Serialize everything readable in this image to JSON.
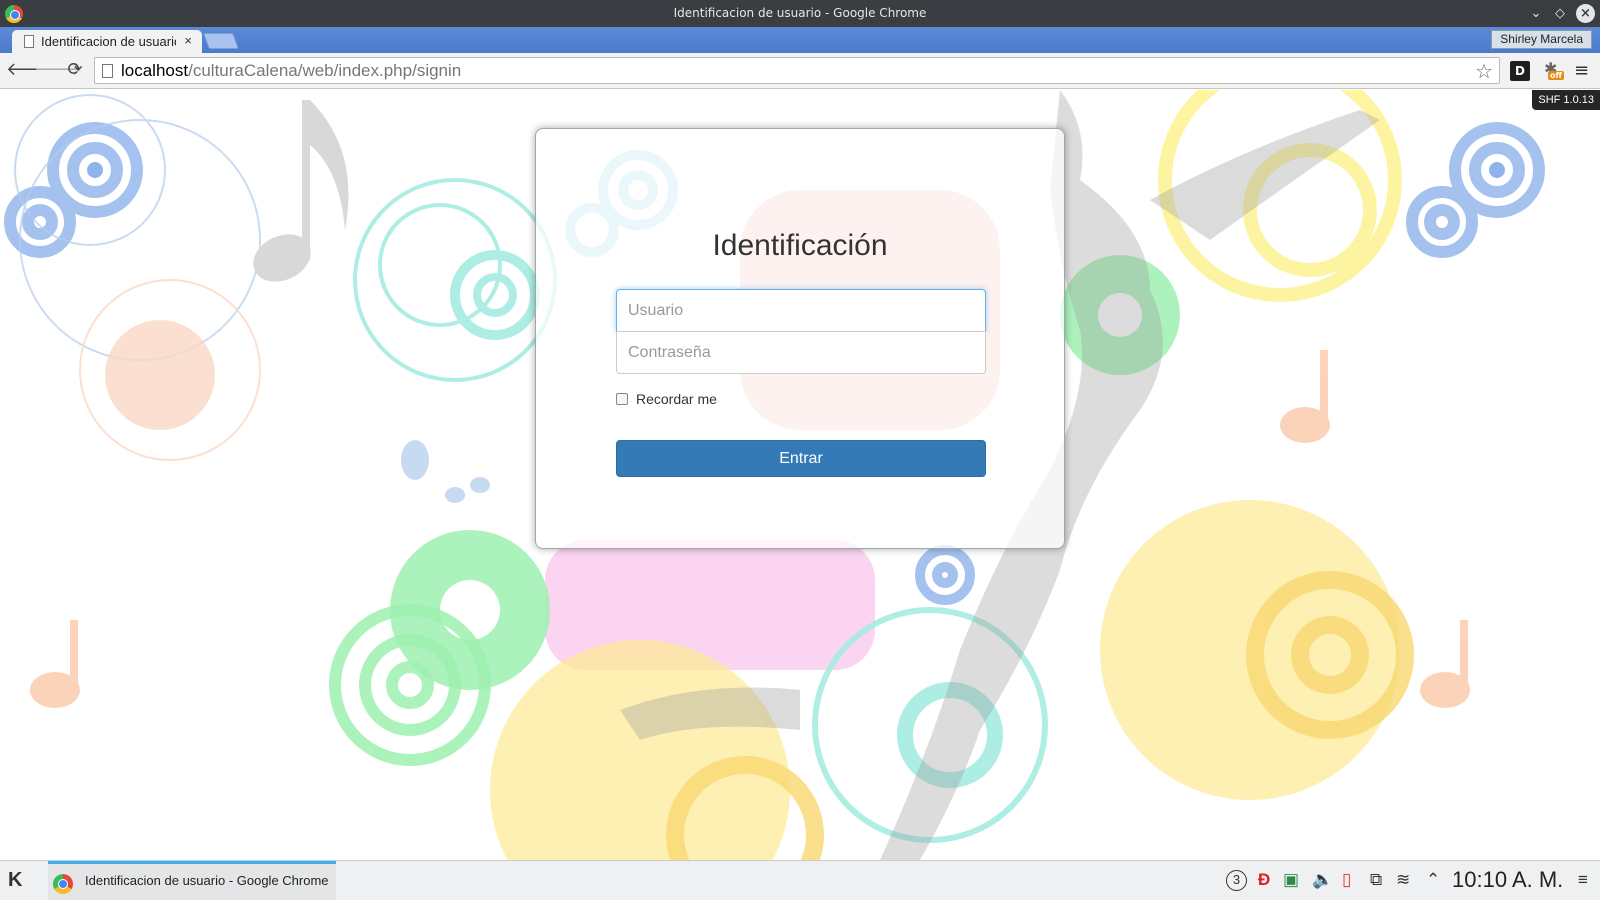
{
  "window": {
    "title": "Identificacion de usuario - Google Chrome",
    "icon": "chrome-icon",
    "controls": [
      "minimize-icon",
      "maximize-icon",
      "close-icon"
    ]
  },
  "tabs": [
    {
      "label": "Identificacion de usuario",
      "close": "×",
      "icon": "document-icon"
    }
  ],
  "profile": {
    "name": "Shirley Marcela"
  },
  "toolbar": {
    "back": "🡐",
    "forward": "🡒",
    "reload": "⟳",
    "url_host": "localhost",
    "url_path": "/culturaCalena/web/index.php/signin",
    "bookmark_icon": "☆",
    "menu_icon": "≡",
    "extensions": {
      "id_label": "D",
      "bug_off_label": "off"
    }
  },
  "page": {
    "badge": "SHF 1.0.13",
    "login": {
      "title": "Identificación",
      "username_placeholder": "Usuario",
      "password_placeholder": "Contraseña",
      "remember_label": "Recordar me",
      "remember_checked": false,
      "submit_label": "Entrar"
    },
    "colors": {
      "primary_button": "#337ab7",
      "focus_border": "#66afe9",
      "tab_strip": "#4a7acb"
    }
  },
  "taskbar": {
    "task_label": "Identificacion de usuario - Google Chrome",
    "clock": "10:10 A. M.",
    "tray_icons": [
      "notifications-count-icon",
      "redshift-icon",
      "network-manager-icon",
      "volume-icon",
      "battery-icon",
      "clipboard-icon",
      "wifi-icon",
      "expand-tray-icon"
    ],
    "tray_count": "3"
  }
}
